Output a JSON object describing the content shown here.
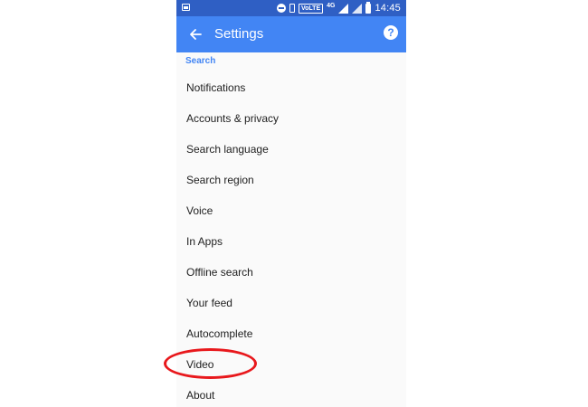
{
  "status_bar": {
    "network_label": "4G",
    "volte_label": "VoLTE",
    "time": "14:45"
  },
  "app_bar": {
    "title": "Settings",
    "help_label": "?",
    "back_icon": "arrow-back-icon"
  },
  "section": {
    "header": "Search"
  },
  "settings_items": [
    {
      "label": "Notifications"
    },
    {
      "label": "Accounts & privacy"
    },
    {
      "label": "Search language"
    },
    {
      "label": "Search region"
    },
    {
      "label": "Voice"
    },
    {
      "label": "In Apps"
    },
    {
      "label": "Offline search"
    },
    {
      "label": "Your feed"
    },
    {
      "label": "Autocomplete"
    },
    {
      "label": "Video"
    },
    {
      "label": "About"
    }
  ],
  "colors": {
    "app_bar": "#4285f4",
    "status_bar": "#2f5fc4",
    "section_header": "#4285f4",
    "highlight": "#e8181c",
    "background": "#fafafa"
  }
}
